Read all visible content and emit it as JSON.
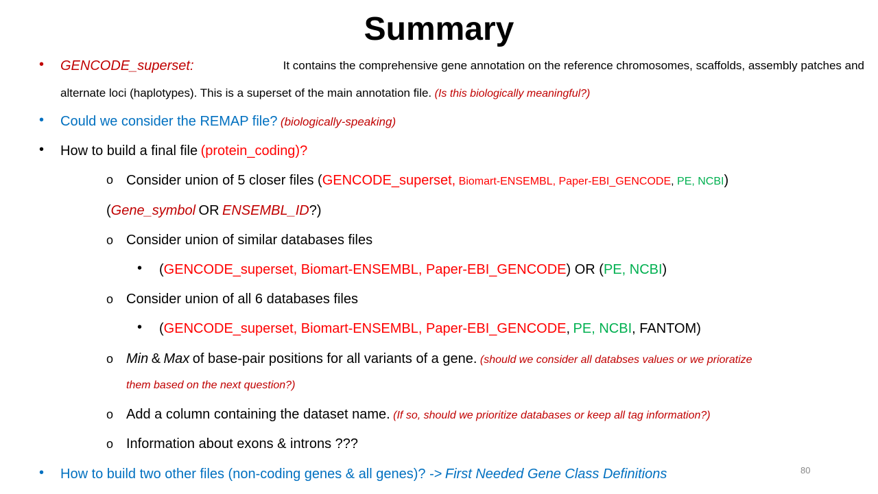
{
  "title": "Summary",
  "page_number": "80",
  "bullet_glyph": "•",
  "sub_glyph": "o",
  "b1": {
    "label": "GENCODE_superset:",
    "text1": "It contains the comprehensive gene annotation on the reference chromosomes, scaffolds, assembly patches and",
    "text2": "alternate loci (haplotypes). This is a superset of the main annotation file.",
    "note": "(Is this biologically meaningful?)"
  },
  "b2": {
    "text": "Could we consider the REMAP file?",
    "note": "(biologically-speaking)"
  },
  "b3": {
    "text": "How to build a final file",
    "highlight": "(protein_coding)?"
  },
  "s1": {
    "text": "Consider union of 5 closer files (",
    "f1": "GENCODE_superset,",
    "f2": "Biomart-ENSEMBL,",
    "f3": "Paper-EBI_GENCODE",
    "comma": ",",
    "f4": "PE, NCBI",
    "close": ")"
  },
  "s1b": {
    "open": "(",
    "a": "Gene_symbol",
    "or": "OR",
    "b": "ENSEMBL_ID",
    "close": "?)"
  },
  "s2": {
    "text": "Consider union of similar databases files"
  },
  "s2a": {
    "open": "(",
    "red": "GENCODE_superset, Biomart-ENSEMBL, Paper-EBI_GENCODE",
    "mid": ") OR (",
    "green": "PE, NCBI",
    "close": ")"
  },
  "s3": {
    "text": "Consider union of all 6 databases files"
  },
  "s3a": {
    "open": "(",
    "red": "GENCODE_superset, Biomart-ENSEMBL, Paper-EBI_GENCODE",
    "comma": ",",
    "green": "PE, NCBI",
    "rest": ", FANTOM)"
  },
  "s4": {
    "min": "Min",
    "amp": "&",
    "max": "Max",
    "text": "of base-pair positions for all variants of a gene.",
    "note1": "(should we consider all databses values or we prioratize",
    "note2": "them based on the next question?)"
  },
  "s5": {
    "text": "Add a column containing the dataset name.",
    "note": "(If so, should we prioritize databases or keep all tag information?)"
  },
  "s6": {
    "text": "Information about exons & introns ???"
  },
  "b4": {
    "text": "How to build two other files (non-coding genes & all genes)? ->",
    "em": "First Needed Gene Class Definitions"
  },
  "colors": {
    "red": "#ff0000",
    "dark_red": "#c00000",
    "blue": "#0070c0",
    "green": "#00b050"
  }
}
